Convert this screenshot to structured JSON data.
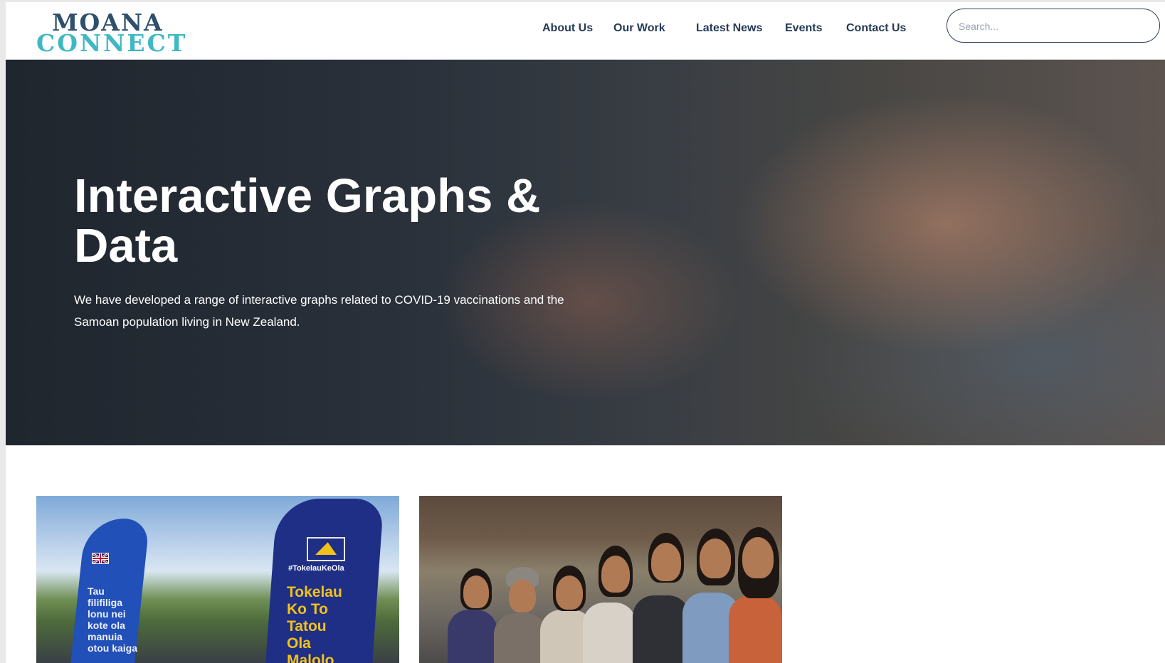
{
  "site": {
    "logo_line1": "MOANA",
    "logo_line2": "CONNECT"
  },
  "nav": {
    "items": [
      {
        "label": "About Us"
      },
      {
        "label": "Our Work"
      },
      {
        "label": "Latest News"
      },
      {
        "label": "Events"
      },
      {
        "label": "Contact Us"
      }
    ]
  },
  "search": {
    "placeholder": "Search..."
  },
  "hero": {
    "title": "Interactive Graphs & Data",
    "subtitle": "We have developed a range of interactive graphs related to COVID-19 vaccinations and the Samoan population living in New Zealand."
  },
  "cards": [
    {
      "image": "vaccination-event-banners",
      "banner_left_text": "Tau\nfilifiliga\nlonu nei\nkote ola\nmanuia\notou kaiga",
      "banner_right_hashtag": "#TokelauKeOla",
      "banner_right_text": "Tokelau\nKo To\nTatou\nOla\nMalolo"
    },
    {
      "image": "group-of-smiling-women"
    }
  ],
  "colors": {
    "nav_text": "#253a56",
    "logo_dark": "#2f4f6b",
    "logo_teal": "#3fb8c4",
    "search_border": "#2e3f57"
  }
}
